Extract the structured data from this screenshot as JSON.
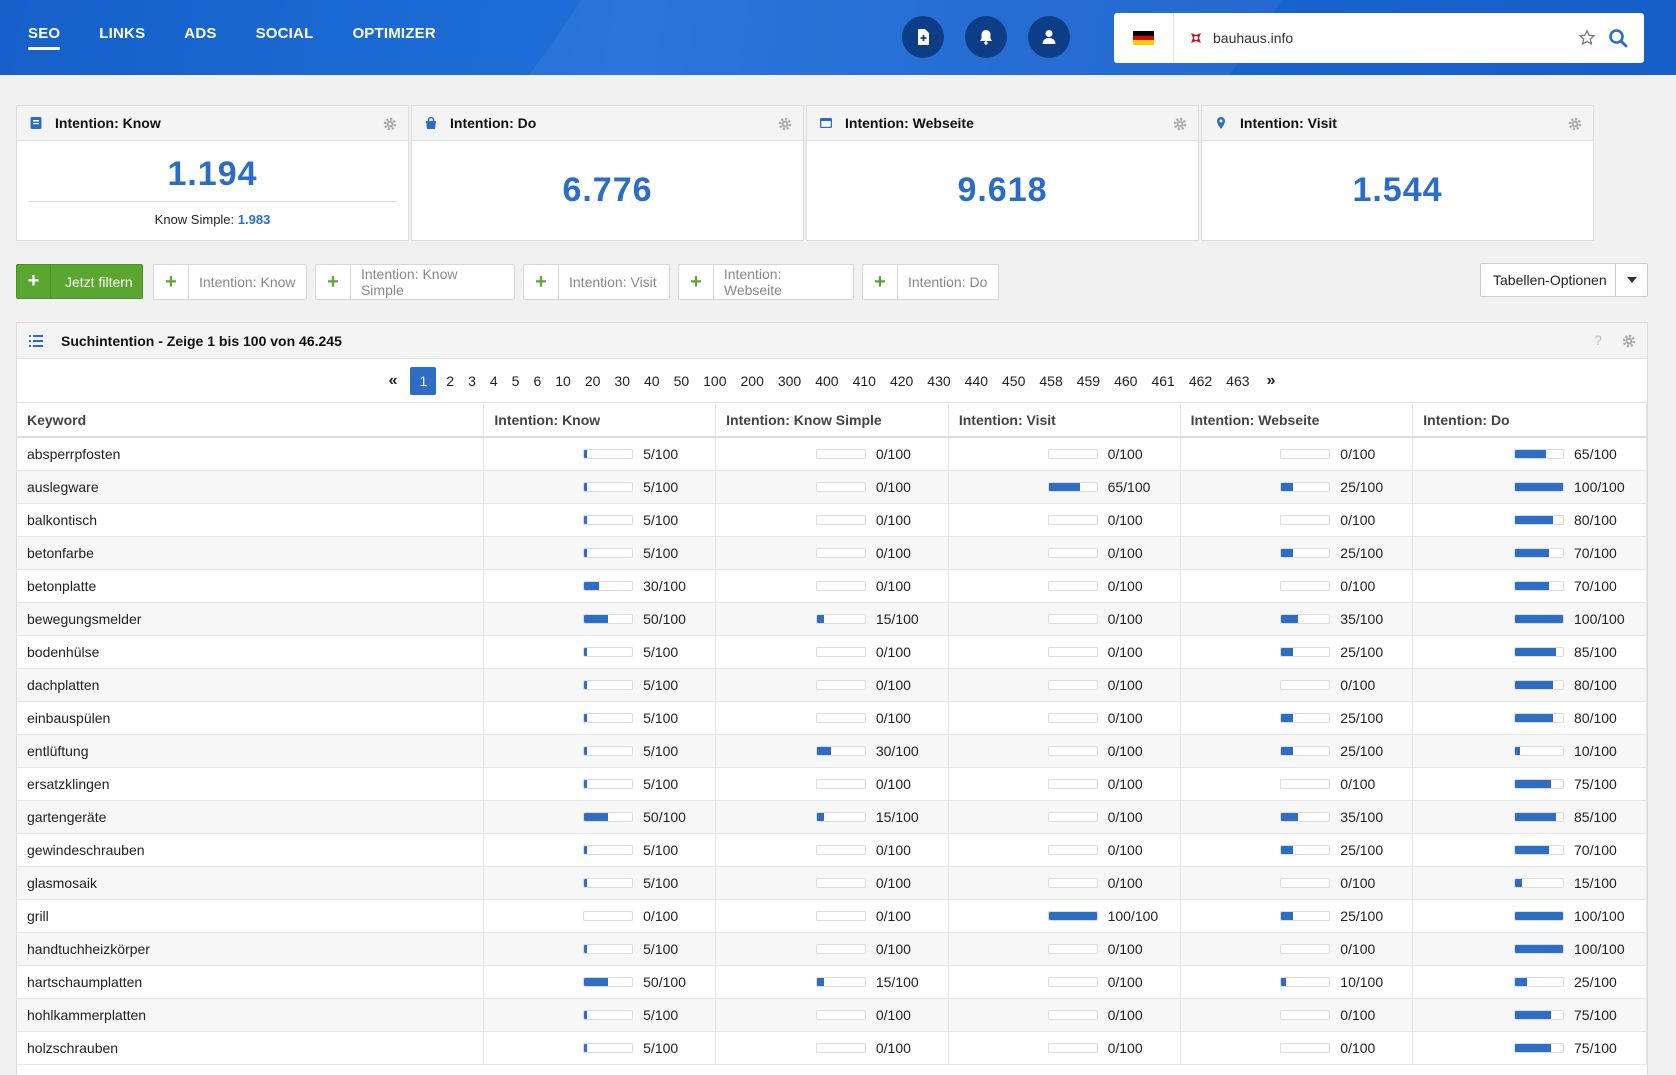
{
  "nav": [
    "SEO",
    "LINKS",
    "ADS",
    "SOCIAL",
    "OPTIMIZER"
  ],
  "header": {
    "domain": "bauhaus.info",
    "flag_colors": [
      "#000000",
      "#dd0000",
      "#ffce00"
    ],
    "icons": [
      "add-report-icon",
      "bell-icon",
      "user-icon",
      "star-icon",
      "search-icon"
    ]
  },
  "cards": [
    {
      "title": "Intention: Know",
      "value": "1.194",
      "sub_label": "Know Simple:",
      "sub_value": "1.983"
    },
    {
      "title": "Intention: Do",
      "value": "6.776"
    },
    {
      "title": "Intention: Webseite",
      "value": "9.618"
    },
    {
      "title": "Intention: Visit",
      "value": "1.544"
    }
  ],
  "filter": {
    "apply_label": "Jetzt filtern",
    "chips": [
      "Intention: Know",
      "Intention: Know Simple",
      "Intention: Visit",
      "Intention: Webseite",
      "Intention: Do"
    ],
    "table_options_label": "Tabellen-Optionen"
  },
  "table": {
    "title": "Suchintention - Zeige 1 bis 100 von 46.245",
    "help": "?",
    "pages": [
      "1",
      "2",
      "3",
      "4",
      "5",
      "6",
      "10",
      "20",
      "30",
      "40",
      "50",
      "100",
      "200",
      "300",
      "400",
      "410",
      "420",
      "430",
      "440",
      "450",
      "458",
      "459",
      "460",
      "461",
      "462",
      "463"
    ],
    "current_page": "1",
    "columns": [
      "Keyword",
      "Intention: Know",
      "Intention: Know Simple",
      "Intention: Visit",
      "Intention: Webseite",
      "Intention: Do"
    ],
    "accent": "#2d6dc4",
    "rows": [
      {
        "keyword": "absperrpfosten",
        "values": [
          5,
          0,
          0,
          0,
          65
        ]
      },
      {
        "keyword": "auslegware",
        "values": [
          5,
          0,
          65,
          25,
          100
        ]
      },
      {
        "keyword": "balkontisch",
        "values": [
          5,
          0,
          0,
          0,
          80
        ]
      },
      {
        "keyword": "betonfarbe",
        "values": [
          5,
          0,
          0,
          25,
          70
        ]
      },
      {
        "keyword": "betonplatte",
        "values": [
          30,
          0,
          0,
          0,
          70
        ]
      },
      {
        "keyword": "bewegungsmelder",
        "values": [
          50,
          15,
          0,
          35,
          100
        ]
      },
      {
        "keyword": "bodenhülse",
        "values": [
          5,
          0,
          0,
          25,
          85
        ]
      },
      {
        "keyword": "dachplatten",
        "values": [
          5,
          0,
          0,
          0,
          80
        ]
      },
      {
        "keyword": "einbauspülen",
        "values": [
          5,
          0,
          0,
          25,
          80
        ]
      },
      {
        "keyword": "entlüftung",
        "values": [
          5,
          30,
          0,
          25,
          10
        ]
      },
      {
        "keyword": "ersatzklingen",
        "values": [
          5,
          0,
          0,
          0,
          75
        ]
      },
      {
        "keyword": "gartengeräte",
        "values": [
          50,
          15,
          0,
          35,
          85
        ]
      },
      {
        "keyword": "gewindeschrauben",
        "values": [
          5,
          0,
          0,
          25,
          70
        ]
      },
      {
        "keyword": "glasmosaik",
        "values": [
          5,
          0,
          0,
          0,
          15
        ]
      },
      {
        "keyword": "grill",
        "values": [
          0,
          0,
          100,
          25,
          100
        ]
      },
      {
        "keyword": "handtuchheizkörper",
        "values": [
          5,
          0,
          0,
          0,
          100
        ]
      },
      {
        "keyword": "hartschaumplatten",
        "values": [
          50,
          15,
          0,
          10,
          25
        ]
      },
      {
        "keyword": "hohlkammerplatten",
        "values": [
          5,
          0,
          0,
          0,
          75
        ]
      },
      {
        "keyword": "holzschrauben",
        "values": [
          5,
          0,
          0,
          0,
          75
        ]
      }
    ]
  }
}
